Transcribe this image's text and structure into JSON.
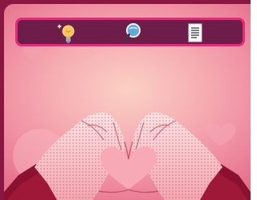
{
  "toolbar": {
    "items": [
      {
        "icon": "lightbulb-icon"
      },
      {
        "icon": "magnifier-icon"
      },
      {
        "icon": "document-icon"
      }
    ]
  },
  "colors": {
    "frame": "#8a1642",
    "toolbar_bg": "#6e1c4a",
    "toolbar_border": "#e8287a",
    "background_center": "#fbd0c4",
    "background_edge": "#e56e8a",
    "sleeve": "#a01838",
    "skin": "#f7c2c6",
    "skin_shadow": "#c95a6e"
  }
}
